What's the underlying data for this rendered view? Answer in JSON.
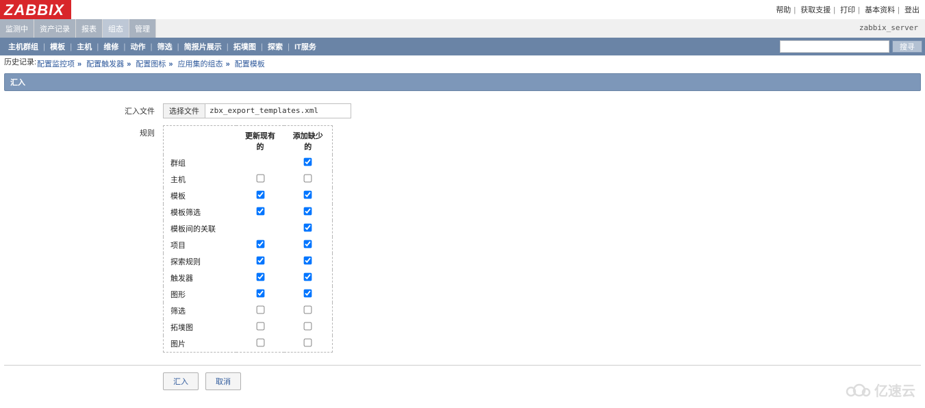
{
  "logo": "ZABBIX",
  "topLinks": {
    "help": "帮助",
    "support": "获取支援",
    "print": "打印",
    "profile": "基本资料",
    "logout": "登出"
  },
  "serverName": "zabbix_server",
  "mainTabs": {
    "monitoring": "监测中",
    "inventory": "资产记录",
    "reports": "报表",
    "configuration": "组态",
    "admin": "管理"
  },
  "subMenu": {
    "hostGroups": "主机群组",
    "templates": "模板",
    "hosts": "主机",
    "maintenance": "维修",
    "actions": "动作",
    "screens": "筛选",
    "slideshows": "简报片展示",
    "maps": "拓墣图",
    "discovery": "探索",
    "itservices": "IT服务"
  },
  "search": {
    "button": "搜寻",
    "value": ""
  },
  "history": {
    "label": "历史记录:",
    "items": [
      "配置监控项",
      "配置触发器",
      "配置图标",
      "应用集的组态",
      "配置模板"
    ]
  },
  "sectionTitle": "汇入",
  "form": {
    "fileLabel": "汇入文件",
    "fileButton": "选择文件",
    "fileName": "zbx_export_templates.xml",
    "rulesLabel": "规则",
    "ruleHeaders": {
      "updateExisting": "更新现有的",
      "addMissing": "添加缺少的"
    },
    "rules": [
      {
        "name": "群组",
        "updateShown": false,
        "updateChecked": false,
        "addShown": true,
        "addChecked": true
      },
      {
        "name": "主机",
        "updateShown": true,
        "updateChecked": false,
        "addShown": true,
        "addChecked": false
      },
      {
        "name": "模板",
        "updateShown": true,
        "updateChecked": true,
        "addShown": true,
        "addChecked": true
      },
      {
        "name": "模板筛选",
        "updateShown": true,
        "updateChecked": true,
        "addShown": true,
        "addChecked": true
      },
      {
        "name": "模板间的关联",
        "updateShown": false,
        "updateChecked": false,
        "addShown": true,
        "addChecked": true
      },
      {
        "name": "项目",
        "updateShown": true,
        "updateChecked": true,
        "addShown": true,
        "addChecked": true
      },
      {
        "name": "探索规则",
        "updateShown": true,
        "updateChecked": true,
        "addShown": true,
        "addChecked": true
      },
      {
        "name": "触发器",
        "updateShown": true,
        "updateChecked": true,
        "addShown": true,
        "addChecked": true
      },
      {
        "name": "图形",
        "updateShown": true,
        "updateChecked": true,
        "addShown": true,
        "addChecked": true
      },
      {
        "name": "筛选",
        "updateShown": true,
        "updateChecked": false,
        "addShown": true,
        "addChecked": false
      },
      {
        "name": "拓墣图",
        "updateShown": true,
        "updateChecked": false,
        "addShown": true,
        "addChecked": false
      },
      {
        "name": "图片",
        "updateShown": true,
        "updateChecked": false,
        "addShown": true,
        "addChecked": false
      }
    ]
  },
  "buttons": {
    "import": "汇入",
    "cancel": "取消"
  },
  "watermark": "亿速云"
}
